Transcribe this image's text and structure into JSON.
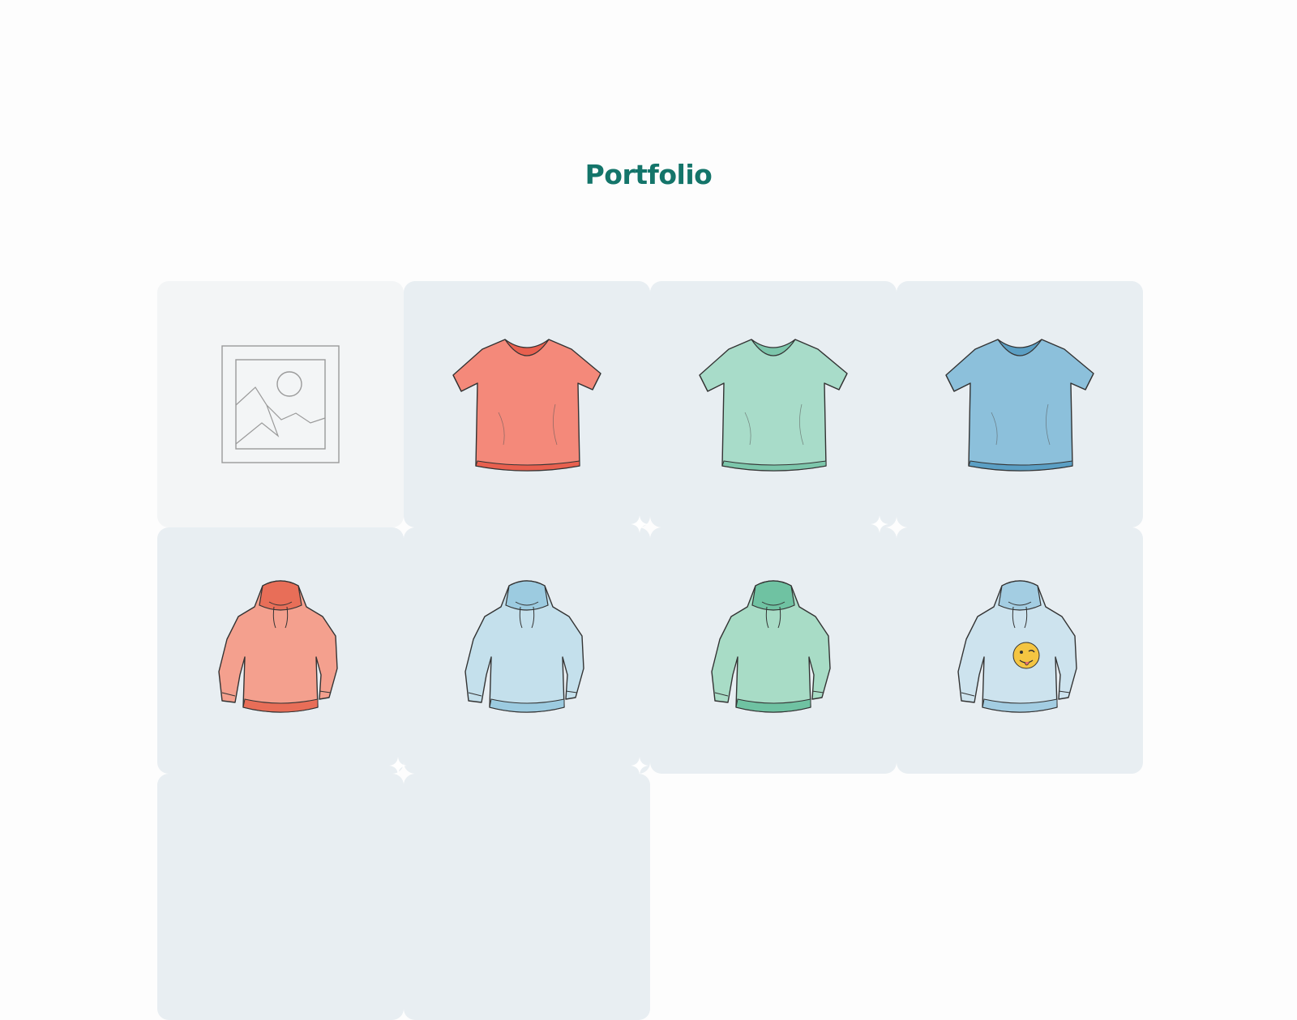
{
  "page": {
    "title": "Portfolio",
    "title_color": "#14756a",
    "tile_bg": "#e8eef2",
    "placeholder_bg": "#f3f5f6"
  },
  "portfolio": {
    "items": [
      {
        "kind": "placeholder",
        "icon": "image-placeholder-icon"
      },
      {
        "kind": "tshirt",
        "color": "#f4897a",
        "shade": "#e8604f",
        "icon": "coral-tshirt-icon"
      },
      {
        "kind": "tshirt",
        "color": "#a8dcc9",
        "shade": "#7cc6ab",
        "icon": "mint-tshirt-icon"
      },
      {
        "kind": "tshirt",
        "color": "#8cc0db",
        "shade": "#5b9fc4",
        "icon": "blue-tshirt-icon"
      },
      {
        "kind": "hoodie",
        "color": "#f4a08e",
        "shade": "#e86e58",
        "icon": "coral-hoodie-icon"
      },
      {
        "kind": "hoodie",
        "color": "#c4e0ec",
        "shade": "#9ccbe0",
        "icon": "light-blue-hoodie-icon"
      },
      {
        "kind": "hoodie",
        "color": "#a8dcc6",
        "shade": "#6fc2a2",
        "icon": "mint-hoodie-icon"
      },
      {
        "kind": "hoodie",
        "color": "#cde3ee",
        "shade": "#a3cde2",
        "icon": "emoji-hoodie-icon",
        "patch": "wink-emoji"
      },
      {
        "kind": "blank",
        "icon": "loading-tile"
      },
      {
        "kind": "blank",
        "icon": "loading-tile"
      }
    ]
  }
}
